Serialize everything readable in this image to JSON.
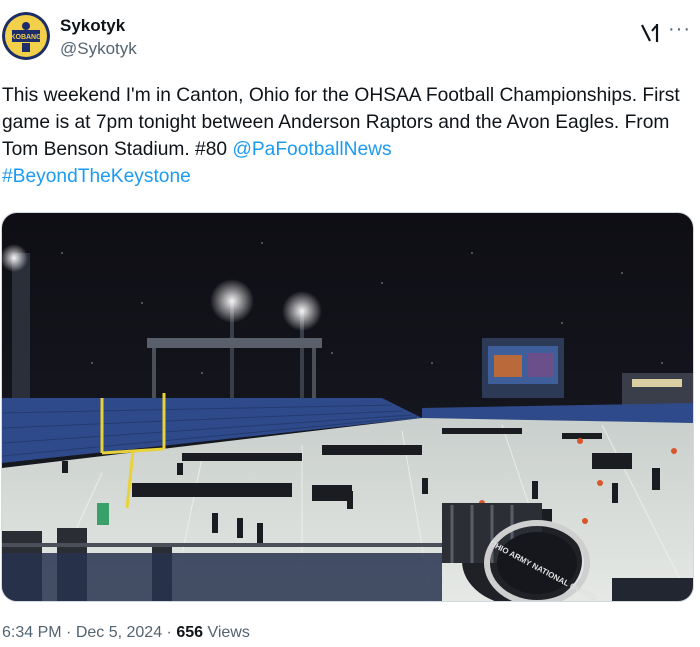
{
  "author": {
    "display_name": "Sykotyk",
    "handle": "@Sykotyk",
    "avatar_icon": "avatar-icon"
  },
  "header_icons": {
    "grok": "grok-icon",
    "more": "···"
  },
  "tweet": {
    "text_main": "This weekend I'm in Canton, Ohio for the OHSAA Football Championships. First game is at 7pm tonight between Anderson Raptors and the Avon Eagles. From Tom Benson Stadium. #80 ",
    "mention": "@PaFootballNews",
    "hashtag": "#BeyondTheKeystone"
  },
  "media": {
    "banner_text": "OHIO ARMY NATIONAL GUARD"
  },
  "meta": {
    "time": "6:34 PM",
    "sep": " · ",
    "date": "Dec 5, 2024",
    "sep2": " · ",
    "views_count": "656",
    "views_label": " Views"
  },
  "colors": {
    "link": "#1d9bf0",
    "secondary": "#536471"
  }
}
